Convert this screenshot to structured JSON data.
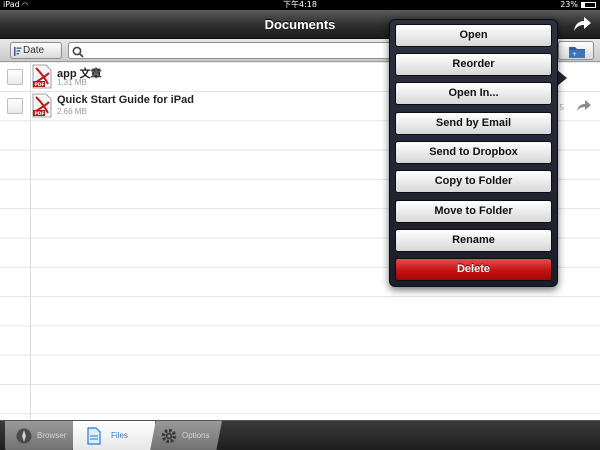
{
  "status_bar": {
    "carrier": "iPad",
    "clock": "下午4:18",
    "battery": "23%"
  },
  "nav_bar": {
    "title": "Documents"
  },
  "toolbar": {
    "sort_label": "Date",
    "search_placeholder": "",
    "search_value": ""
  },
  "files": [
    {
      "name": "app 文章",
      "size": "1.31 MB",
      "meta": ""
    },
    {
      "name": "Quick Start Guide for iPad",
      "size": "2.66 MB",
      "meta": "5"
    }
  ],
  "tabs": [
    {
      "label": "Browser",
      "icon": "compass-icon",
      "selected": false
    },
    {
      "label": "Files",
      "icon": "document-icon",
      "selected": true
    },
    {
      "label": "Options",
      "icon": "gear-icon",
      "selected": false
    }
  ],
  "actions": {
    "open": "Open",
    "reorder": "Reorder",
    "open_in": "Open In...",
    "send_email": "Send by Email",
    "send_dropbox": "Send to Dropbox",
    "copy_folder": "Copy to Folder",
    "move_folder": "Move to Folder",
    "rename": "Rename",
    "delete": "Delete"
  },
  "colors": {
    "accent": "#2a7ccf",
    "danger": "#c41212",
    "nav": "#2d2d2d"
  }
}
